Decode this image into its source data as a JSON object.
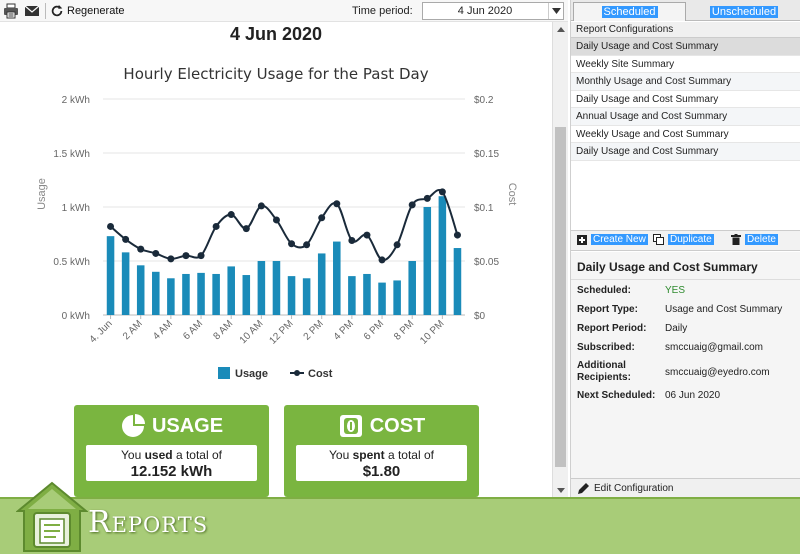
{
  "toolbar": {
    "regenerate_label": "Regenerate",
    "period_label": "Time period:",
    "period_value": "4 Jun 2020"
  },
  "report": {
    "date_heading": "4 Jun 2020"
  },
  "chart_data": {
    "type": "bar+line",
    "title": "Hourly Electricity Usage for the Past Day",
    "ylabel_left": "Usage",
    "ylabel_right": "Cost",
    "y_ticks_left": [
      "0 kWh",
      "0.5 kWh",
      "1 kWh",
      "1.5 kWh",
      "2 kWh"
    ],
    "y_ticks_right": [
      "$0",
      "$0.05",
      "$0.1",
      "$0.15",
      "$0.2"
    ],
    "ylim_left": [
      0,
      2
    ],
    "ylim_right": [
      0,
      0.2
    ],
    "x_tick_labels": [
      "4. Jun",
      "2 AM",
      "4 AM",
      "6 AM",
      "8 AM",
      "10 AM",
      "12 PM",
      "2 PM",
      "4 PM",
      "6 PM",
      "8 PM",
      "10 PM"
    ],
    "grid": true,
    "legend_position": "bottom",
    "series": [
      {
        "name": "Usage",
        "type": "bar",
        "color": "#1a8bb9",
        "values": [
          0.73,
          0.58,
          0.46,
          0.4,
          0.34,
          0.38,
          0.39,
          0.38,
          0.45,
          0.37,
          0.5,
          0.5,
          0.36,
          0.34,
          0.57,
          0.68,
          0.36,
          0.38,
          0.3,
          0.32,
          0.5,
          1.0,
          1.1,
          0.62
        ]
      },
      {
        "name": "Cost",
        "type": "line",
        "color": "#1a2a3a",
        "values": [
          0.082,
          0.07,
          0.061,
          0.057,
          0.052,
          0.055,
          0.055,
          0.082,
          0.093,
          0.08,
          0.101,
          0.088,
          0.066,
          0.065,
          0.09,
          0.103,
          0.069,
          0.074,
          0.051,
          0.065,
          0.102,
          0.108,
          0.114,
          0.074
        ]
      }
    ]
  },
  "cards": {
    "usage": {
      "title": "USAGE",
      "pre": "You ",
      "verb": "used",
      "post": " a total of",
      "value": "12.152 kWh"
    },
    "cost": {
      "title": "COST",
      "pre": "You ",
      "verb": "spent",
      "post": " a total of",
      "value": "$1.80"
    }
  },
  "tabs": {
    "scheduled": "Scheduled",
    "unscheduled": "Unscheduled"
  },
  "configs": {
    "header": "Report Configurations",
    "items": [
      "Daily Usage and Cost Summary",
      "Weekly Site Summary",
      "Monthly Usage and Cost Summary",
      "Daily Usage and Cost Summary",
      "Annual Usage and Cost Summary",
      "Weekly Usage and Cost Summary",
      "Daily Usage and Cost Summary"
    ]
  },
  "actions": {
    "create": "Create New",
    "duplicate": "Duplicate",
    "delete": "Delete"
  },
  "details": {
    "title": "Daily Usage and Cost Summary",
    "rows": [
      {
        "label": "Scheduled:",
        "value": "YES"
      },
      {
        "label": "Report Type:",
        "value": "Usage and Cost Summary"
      },
      {
        "label": "Report Period:",
        "value": "Daily"
      },
      {
        "label": "Subscribed:",
        "value": "smccuaig@gmail.com"
      },
      {
        "label": "Additional Recipients:",
        "value": "smccuaig@eyedro.com"
      },
      {
        "label": "Next Scheduled:",
        "value": "06 Jun 2020"
      }
    ],
    "edit_label": "Edit Configuration"
  },
  "banner": {
    "title": "Reports"
  }
}
